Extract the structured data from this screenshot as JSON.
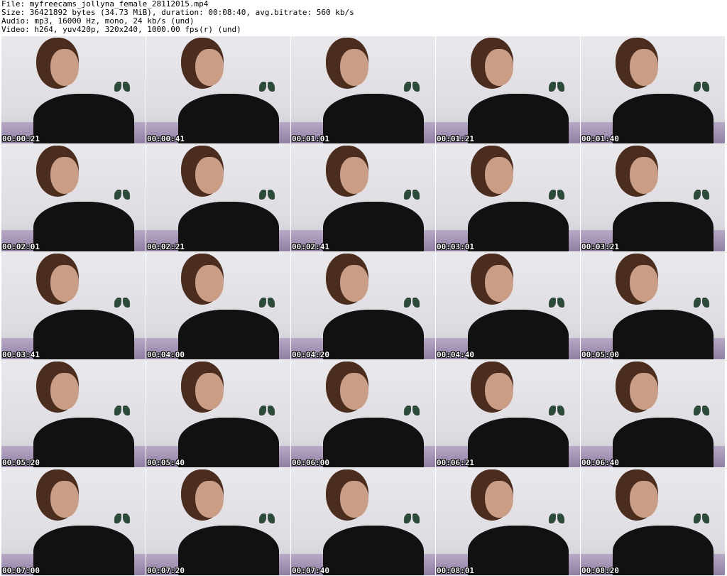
{
  "header": {
    "file_line": "File: myfreecams_jollyna_female_28112015.mp4",
    "size_line": "Size: 36421892 bytes (34.73 MiB), duration: 00:08:40, avg.bitrate: 560 kb/s",
    "audio_line": "Audio: mp3, 16000 Hz, mono, 24 kb/s (und)",
    "video_line": "Video: h264, yuv420p, 320x240, 1000.00 fps(r) (und)"
  },
  "thumbnails": [
    {
      "timestamp": "00:00:21"
    },
    {
      "timestamp": "00:00:41"
    },
    {
      "timestamp": "00:01:01"
    },
    {
      "timestamp": "00:01:21"
    },
    {
      "timestamp": "00:01:40"
    },
    {
      "timestamp": "00:02:01"
    },
    {
      "timestamp": "00:02:21"
    },
    {
      "timestamp": "00:02:41"
    },
    {
      "timestamp": "00:03:01"
    },
    {
      "timestamp": "00:03:21"
    },
    {
      "timestamp": "00:03:41"
    },
    {
      "timestamp": "00:04:00"
    },
    {
      "timestamp": "00:04:20"
    },
    {
      "timestamp": "00:04:40"
    },
    {
      "timestamp": "00:05:00"
    },
    {
      "timestamp": "00:05:20"
    },
    {
      "timestamp": "00:05:40"
    },
    {
      "timestamp": "00:06:00"
    },
    {
      "timestamp": "00:06:21"
    },
    {
      "timestamp": "00:06:40"
    },
    {
      "timestamp": "00:07:00"
    },
    {
      "timestamp": "00:07:20"
    },
    {
      "timestamp": "00:07:40"
    },
    {
      "timestamp": "00:08:01"
    },
    {
      "timestamp": "00:08:20"
    }
  ]
}
